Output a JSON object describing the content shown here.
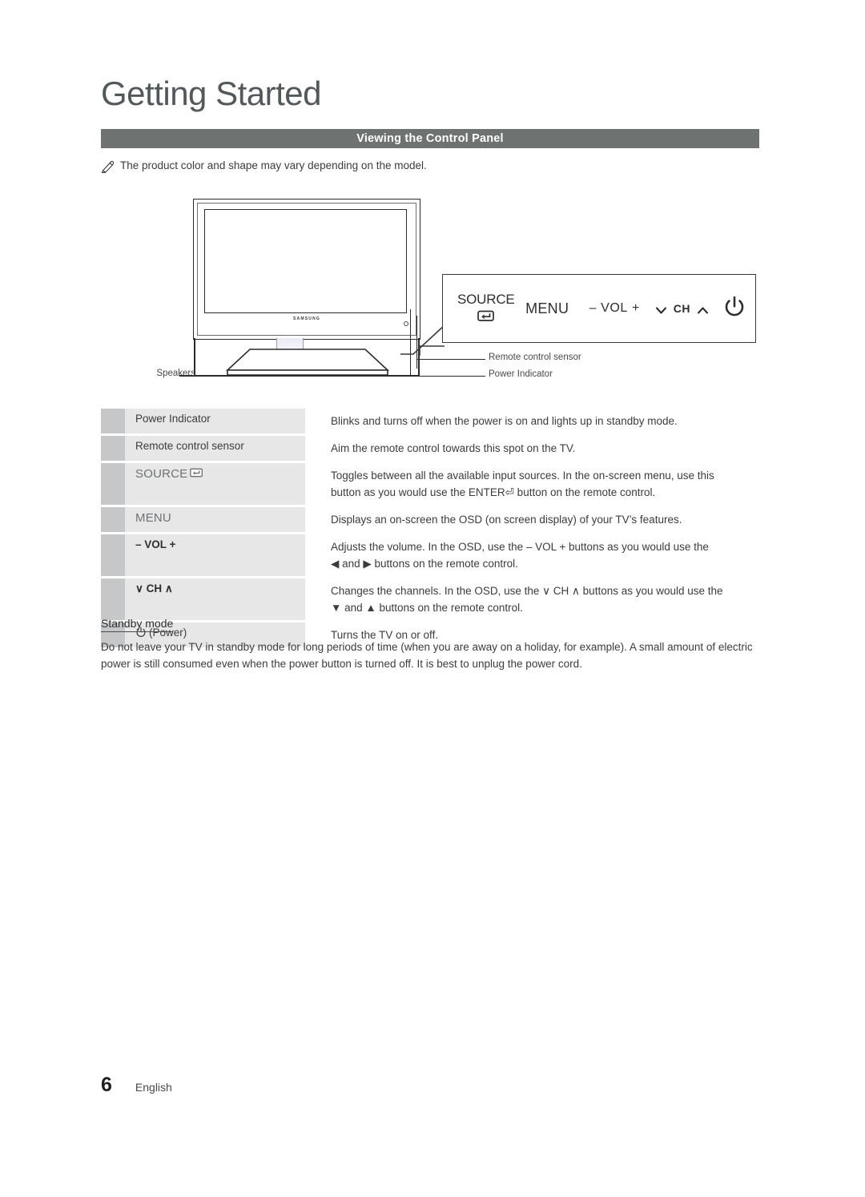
{
  "header": {
    "chapter_title": "Getting Started",
    "section_title": "Viewing the Control Panel"
  },
  "note": {
    "icon": "pencil-icon",
    "text": "The product color and shape may vary depending on the model."
  },
  "diagram": {
    "tv_brand_logo": "SAMSUNG",
    "labels": {
      "speakers": "Speakers",
      "remote_control_sensor": "Remote control sensor",
      "power_indicator": "Power Indicator"
    },
    "control_panel_buttons": [
      {
        "id": "source",
        "label": "SOURCE",
        "icon": "enter-icon"
      },
      {
        "id": "menu",
        "label": "MENU"
      },
      {
        "id": "volume",
        "minus": "–",
        "label": "VOL",
        "plus": "+"
      },
      {
        "id": "channel",
        "down_icon": "chevron-down-icon",
        "label": "CH",
        "up_icon": "chevron-up-icon"
      },
      {
        "id": "power",
        "icon": "power-icon"
      }
    ]
  },
  "table": {
    "rows": [
      {
        "key": "Power Indicator",
        "key_style": "plain",
        "lines": [
          "Blinks and turns off when the power is on and lights up in standby mode."
        ]
      },
      {
        "key": "Remote control sensor",
        "key_style": "plain",
        "lines": [
          "Aim the remote control towards this spot on the TV."
        ]
      },
      {
        "key": "SOURCE",
        "key_style": "tinted",
        "key_icon": "enter-icon",
        "lines": [
          "Toggles between all the available input sources. In the on-screen menu, use this",
          "button as you would use the ENTER⏎ button on the remote control."
        ]
      },
      {
        "key": "MENU",
        "key_style": "tinted",
        "lines": [
          "Displays an on-screen the OSD (on screen display) of your TV’s features."
        ]
      },
      {
        "key": "– VOL +",
        "key_style": "strong",
        "lines": [
          "Adjusts the volume. In the OSD, use the – VOL + buttons as you would use the",
          "◀ and ▶ buttons on the remote control."
        ]
      },
      {
        "key": "∨ CH ∧",
        "key_style": "strong",
        "lines": [
          "Changes the channels. In the OSD, use the ∨ CH ∧ buttons as you would use the",
          "▼ and ▲ buttons on the remote control."
        ]
      },
      {
        "key": "(Power)",
        "key_style": "plain",
        "key_icon": "power-icon",
        "lines": [
          "Turns the TV on or off."
        ]
      }
    ]
  },
  "standby": {
    "heading": "Standby mode",
    "body": "Do not leave your TV in standby mode for long periods of time (when you are away on a holiday, for example). A small amount of electric power is still consumed even when the power button is turned off. It is best to unplug the power cord."
  },
  "footer": {
    "page_number": "6",
    "language": "English"
  },
  "colors": {
    "section_bar": "#6e7271",
    "swatch": "#c6c7c8",
    "key_cell": "#e7e7e7",
    "text": "#3c3c3c",
    "tint": "#6e7275"
  }
}
